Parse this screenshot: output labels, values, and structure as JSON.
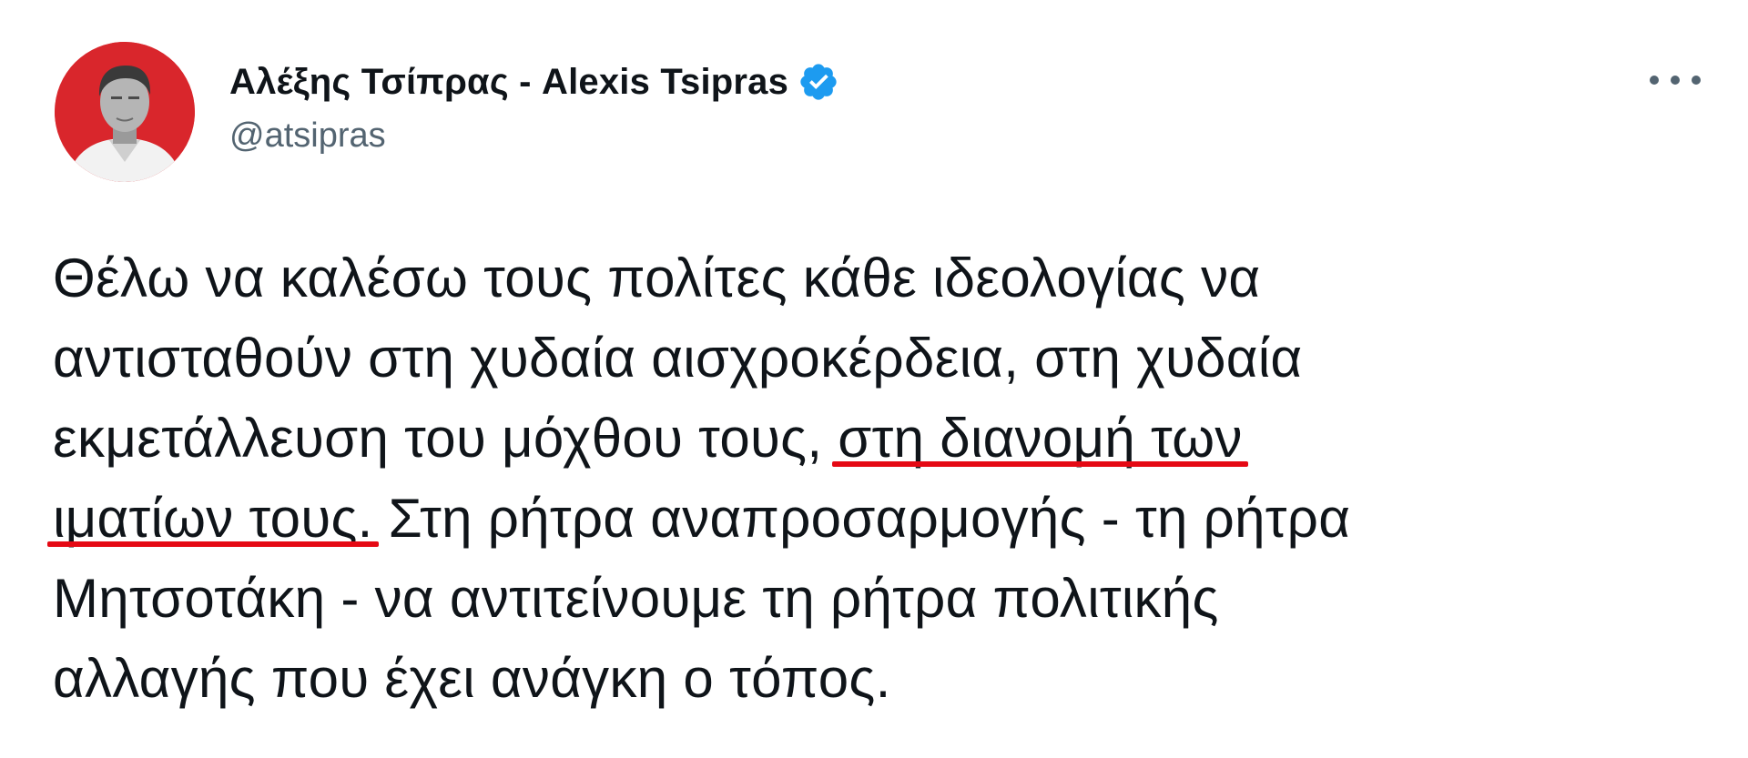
{
  "author": {
    "display_name": "Αλέξης Τσίπρας - Alexis Tsipras",
    "handle": "@atsipras",
    "verified_icon": "verified-badge-icon",
    "avatar_bg": "#d9262c"
  },
  "menu": {
    "icon": "more-options-icon"
  },
  "tweet": {
    "lines": [
      {
        "before": "Θέλω να καλέσω τους πολίτες κάθε ιδεολογίας να",
        "highlight": "",
        "after": ""
      },
      {
        "before": "αντισταθούν στη χυδαία αισχροκέρδεια, στη χυδαία",
        "highlight": "",
        "after": ""
      },
      {
        "before": "εκμετάλλευση του μόχθου τους, ",
        "highlight": "στη διανομή των",
        "after": ""
      },
      {
        "before": "",
        "highlight": "ιματίων τους.",
        "after": " Στη ρήτρα αναπροσαρμογής - τη ρήτρα"
      },
      {
        "before": "Μητσοτάκη - να αντιτείνουμε τη ρήτρα πολιτικής",
        "highlight": "",
        "after": ""
      },
      {
        "before": "αλλαγής που έχει ανάγκη ο τόπος.",
        "highlight": "",
        "after": ""
      }
    ],
    "underline_color": "#e50914"
  }
}
